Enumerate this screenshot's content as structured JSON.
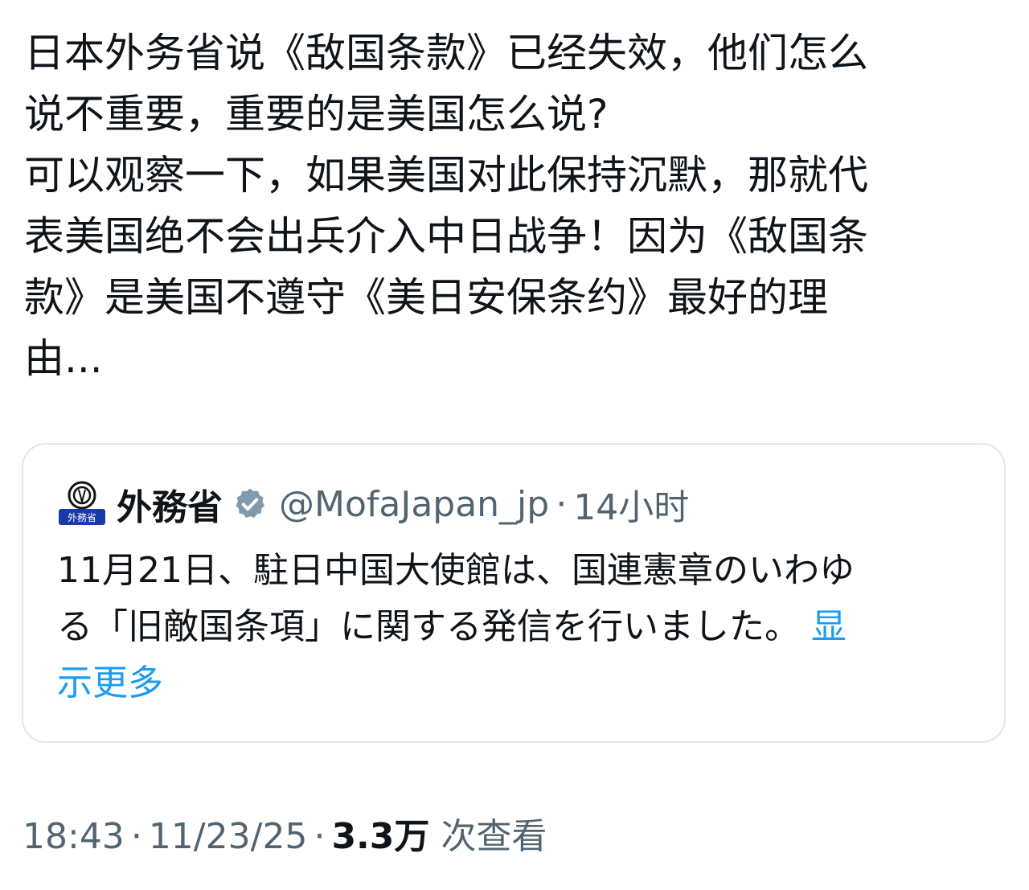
{
  "post": {
    "lines": [
      "日本外务省说《敌国条款》已经失效，他们怎么",
      "说不重要，重要的是美国怎么说?",
      "可以观察一下，如果美国对此保持沉默，那就代",
      "表美国绝不会出兵介入中日战争！因为《敌国条",
      "款》是美国不遵守《美日安保条约》最好的理",
      "由..."
    ]
  },
  "quoted": {
    "avatar_label": "外務省",
    "display_name": "外務省",
    "verified_icon": "verified-badge-gray",
    "handle": "@MofaJapan_jp",
    "separator": "·",
    "time": "14小时",
    "body_lines": [
      "11月21日、駐日中国大使館は、国連憲章のいわゆ",
      "る「旧敵国条項」に関する発信を行いました。",
      "示更多"
    ],
    "show_more_first": "显",
    "colors": {
      "link": "#1d9bf0",
      "secondary": "#536471",
      "border": "#e1e6ea",
      "avatar_blue": "#1a3aa8"
    }
  },
  "footer": {
    "time": "18:43",
    "separator": "·",
    "date": "11/23/25",
    "views_count": "3.3万",
    "views_label": "次查看"
  }
}
